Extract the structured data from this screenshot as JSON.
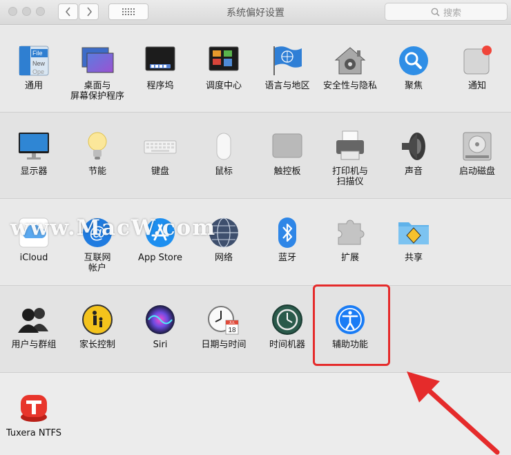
{
  "window": {
    "title": "系统偏好设置"
  },
  "search": {
    "placeholder": "搜索"
  },
  "icons": {
    "back": "chevron-left-icon",
    "forward": "chevron-right-icon",
    "grid": "grid-icon",
    "search": "magnifier-icon"
  },
  "sections": [
    {
      "items": [
        {
          "label": "通用"
        },
        {
          "label": "桌面与\n屏幕保护程序"
        },
        {
          "label": "程序坞"
        },
        {
          "label": "调度中心"
        },
        {
          "label": "语言与地区"
        },
        {
          "label": "安全性与隐私"
        },
        {
          "label": "聚焦"
        },
        {
          "label": "通知"
        }
      ]
    },
    {
      "items": [
        {
          "label": "显示器"
        },
        {
          "label": "节能"
        },
        {
          "label": "键盘"
        },
        {
          "label": "鼠标"
        },
        {
          "label": "触控板"
        },
        {
          "label": "打印机与\n扫描仪"
        },
        {
          "label": "声音"
        },
        {
          "label": "启动磁盘"
        }
      ]
    },
    {
      "items": [
        {
          "label": "iCloud"
        },
        {
          "label": "互联网\n帐户"
        },
        {
          "label": "App Store"
        },
        {
          "label": "网络"
        },
        {
          "label": "蓝牙"
        },
        {
          "label": "扩展"
        },
        {
          "label": "共享"
        }
      ]
    },
    {
      "items": [
        {
          "label": "用户与群组"
        },
        {
          "label": "家长控制"
        },
        {
          "label": "Siri"
        },
        {
          "label": "日期与时间"
        },
        {
          "label": "时间机器"
        },
        {
          "label": "辅助功能"
        }
      ]
    },
    {
      "items": [
        {
          "label": "Tuxera NTFS"
        }
      ]
    }
  ],
  "icon_texts": {
    "general_file": "File",
    "general_new": "New",
    "general_ope": "Ope",
    "calendar_month": "JUL",
    "calendar_day": "18"
  },
  "watermark": "www.MacW.com",
  "colors": {
    "highlight": "#e52b2b",
    "accent": "#1a7cf5"
  }
}
